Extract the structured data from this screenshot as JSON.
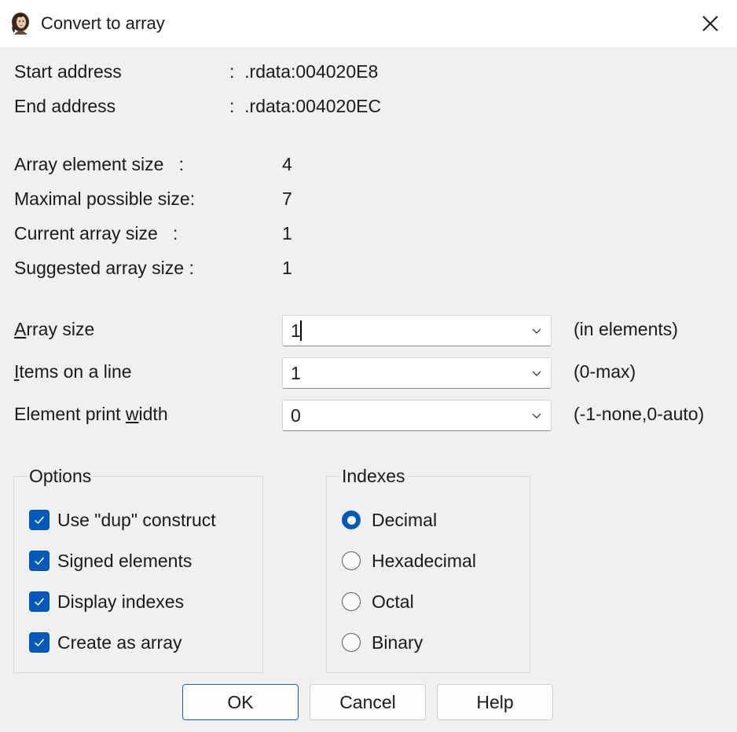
{
  "window": {
    "title": "Convert to array",
    "icon": "woman-portrait-icon",
    "close_icon": "close-icon"
  },
  "address": {
    "start_label": "Start address",
    "start_value": ":  .rdata:004020E8",
    "end_label": "End address",
    "end_value": ":  .rdata:004020EC"
  },
  "info": {
    "element_size_label": "Array element size   :",
    "element_size_value": "4",
    "max_size_label": "Maximal possible size:",
    "max_size_value": "7",
    "current_size_label": "Current array size   :",
    "current_size_value": "1",
    "suggested_size_label": "Suggested array size :",
    "suggested_size_value": "1"
  },
  "fields": {
    "array_size": {
      "label_pre": "",
      "label_accel": "A",
      "label_post": "rray size",
      "value": "1",
      "hint": "(in elements)"
    },
    "items_per_line": {
      "label_pre": "",
      "label_accel": "I",
      "label_post": "tems on a line",
      "value": "1",
      "hint": "(0-max)"
    },
    "print_width": {
      "label_pre": "Element print ",
      "label_accel": "w",
      "label_post": "idth",
      "value": "0",
      "hint": "(-1-none,0-auto)"
    }
  },
  "options": {
    "title": "Options",
    "items": [
      {
        "label": "Use \"dup\" construct",
        "checked": true
      },
      {
        "label": "Signed elements",
        "checked": true
      },
      {
        "label": "Display indexes",
        "checked": true
      },
      {
        "label": "Create as array",
        "checked": true
      }
    ]
  },
  "indexes": {
    "title": "Indexes",
    "items": [
      {
        "label": "Decimal",
        "selected": true
      },
      {
        "label": "Hexadecimal",
        "selected": false
      },
      {
        "label": "Octal",
        "selected": false
      },
      {
        "label": "Binary",
        "selected": false
      }
    ]
  },
  "buttons": {
    "ok": "OK",
    "cancel": "Cancel",
    "help": "Help"
  },
  "colors": {
    "accent": "#0059b8",
    "background": "#f0f0f0",
    "titlebar": "#ffffff"
  }
}
